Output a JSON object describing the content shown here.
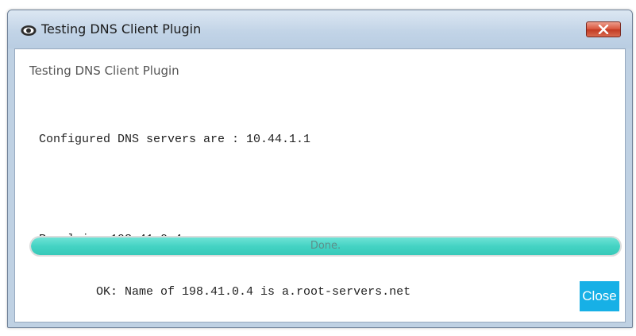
{
  "window": {
    "title": "Testing DNS Client Plugin",
    "close_icon": "close-x-icon",
    "app_icon": "eye-icon"
  },
  "panel": {
    "title": "Testing DNS Client Plugin"
  },
  "output": {
    "lines": [
      "Configured DNS servers are : 10.44.1.1",
      "Resolving 198.41.0.4 ...",
      "        OK: Name of 198.41.0.4 is a.root-servers.net"
    ]
  },
  "progress": {
    "text": "Done.",
    "percent": 100
  },
  "buttons": {
    "close_label": "Close"
  },
  "colors": {
    "accent": "#17b0e6",
    "progress_fill": "#44d3c4",
    "title_bar": "#c2d4e7",
    "close_x": "#c23a22"
  }
}
